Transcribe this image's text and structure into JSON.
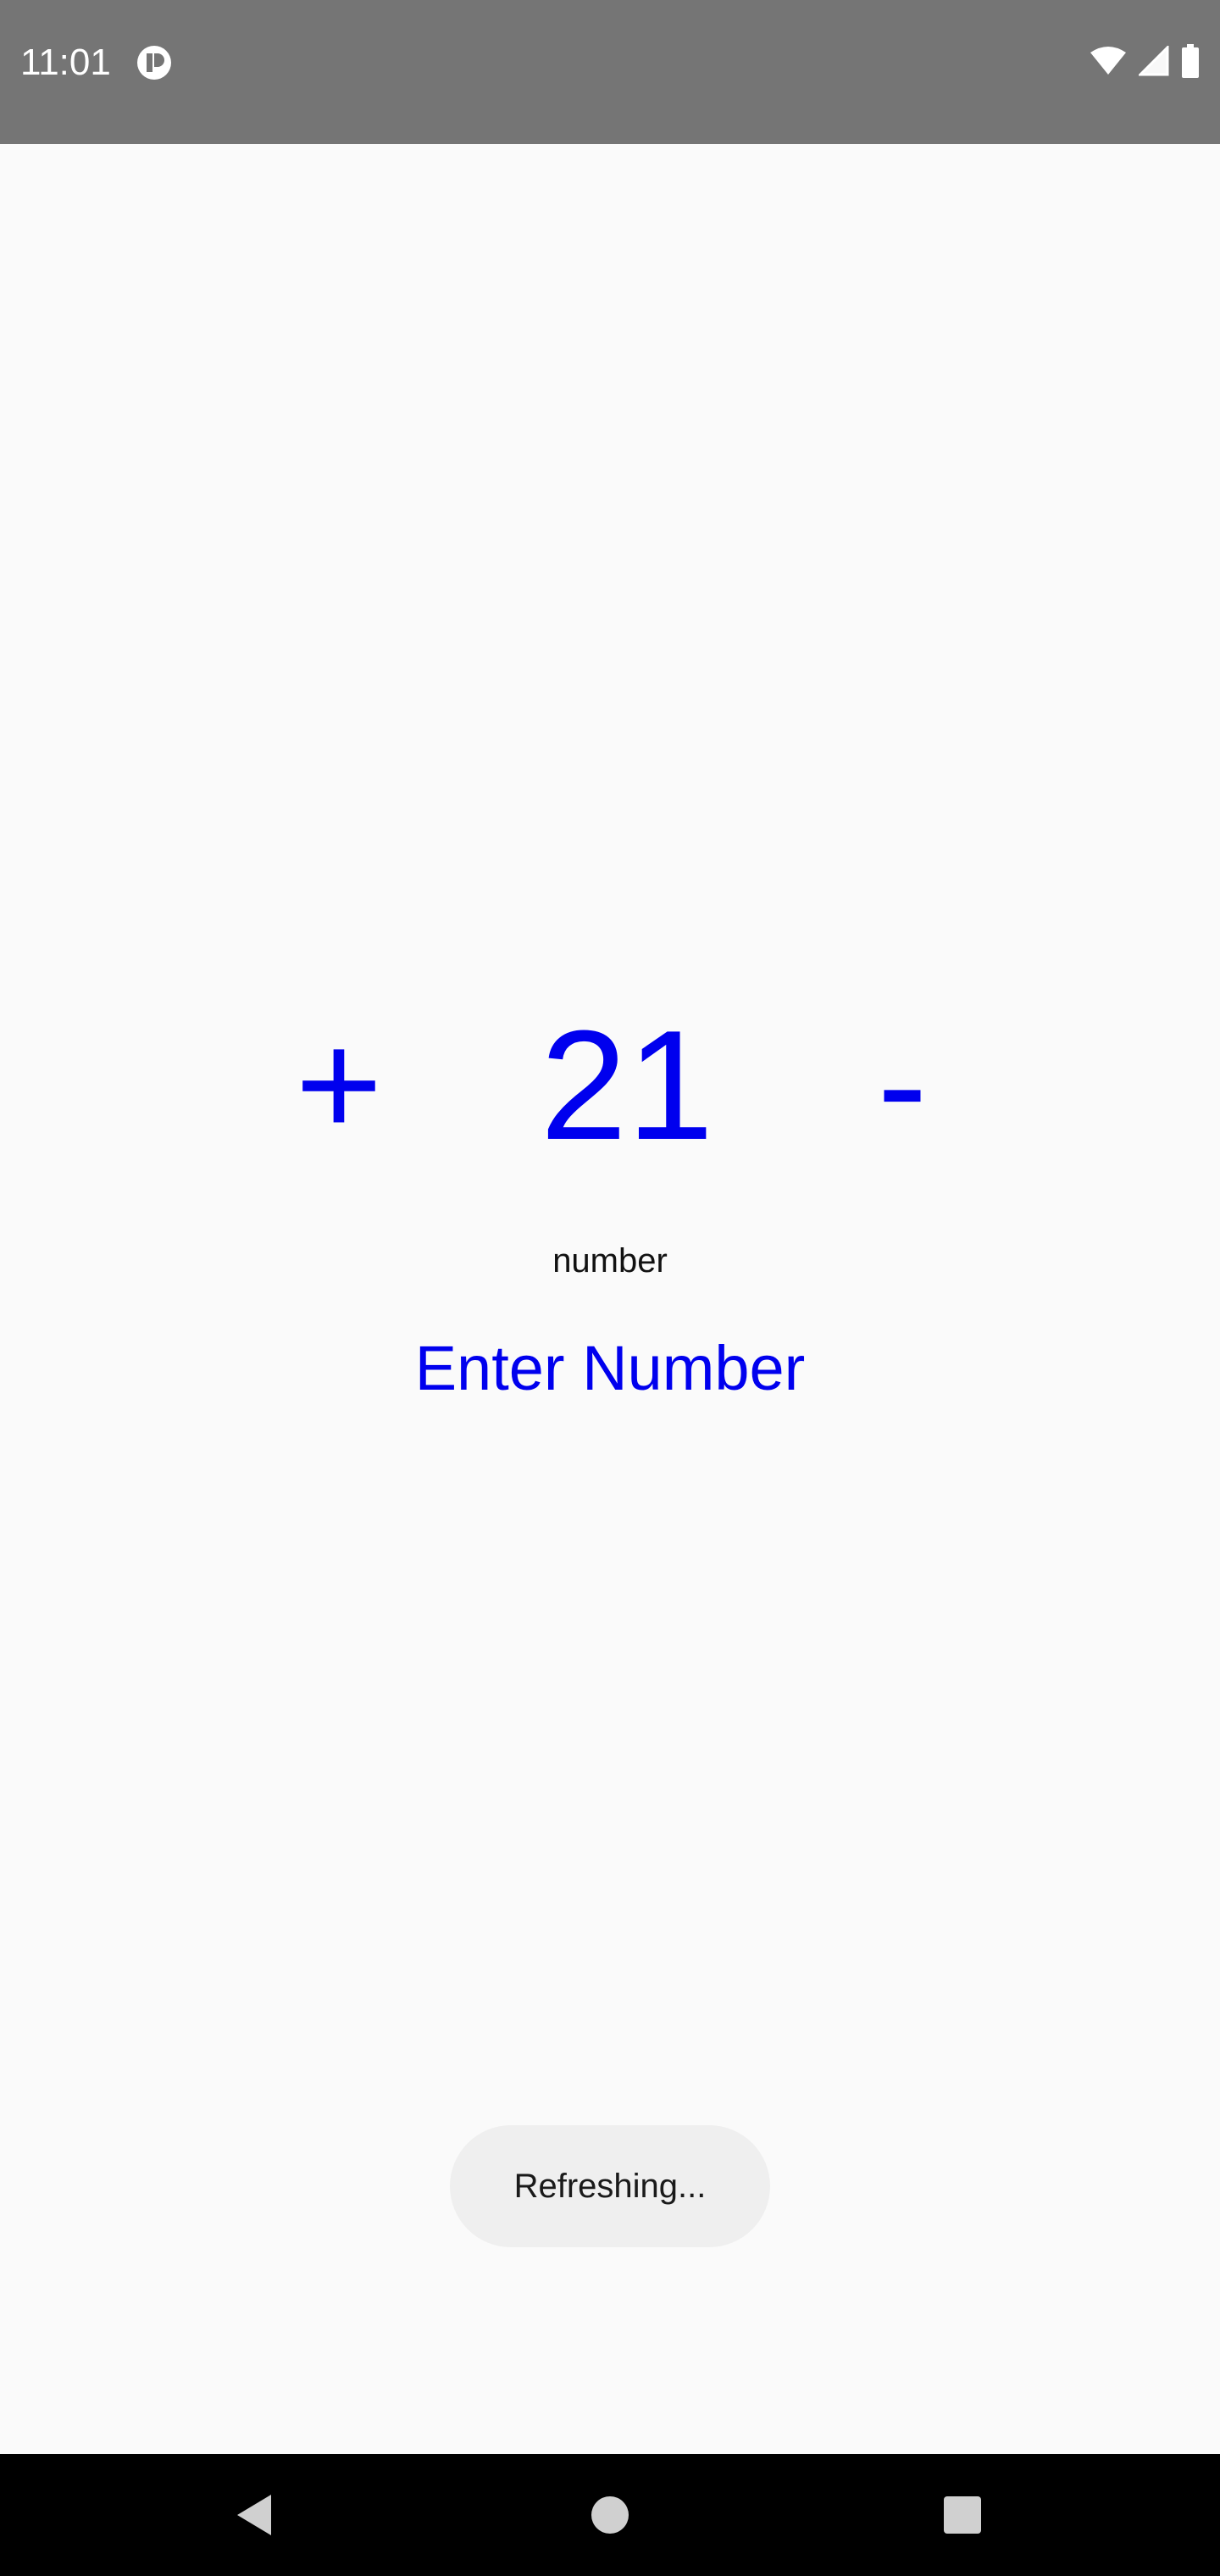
{
  "status_bar": {
    "time": "11:01",
    "icons": [
      "app-notification-icon",
      "wifi-icon",
      "cell-signal-icon",
      "battery-icon"
    ]
  },
  "stepper": {
    "plus_label": "+",
    "value": "21",
    "minus_label": "-"
  },
  "number_label": "number",
  "enter_button_label": "Enter Number",
  "toast": {
    "message": "Refreshing..."
  },
  "nav_bar": {
    "buttons": [
      "back-icon",
      "home-icon",
      "recents-icon"
    ]
  },
  "colors": {
    "accent": "#0000ee",
    "status_bar": "#757575",
    "background": "#fafafa",
    "nav_bar": "#000000",
    "toast_bg": "#efefef"
  }
}
